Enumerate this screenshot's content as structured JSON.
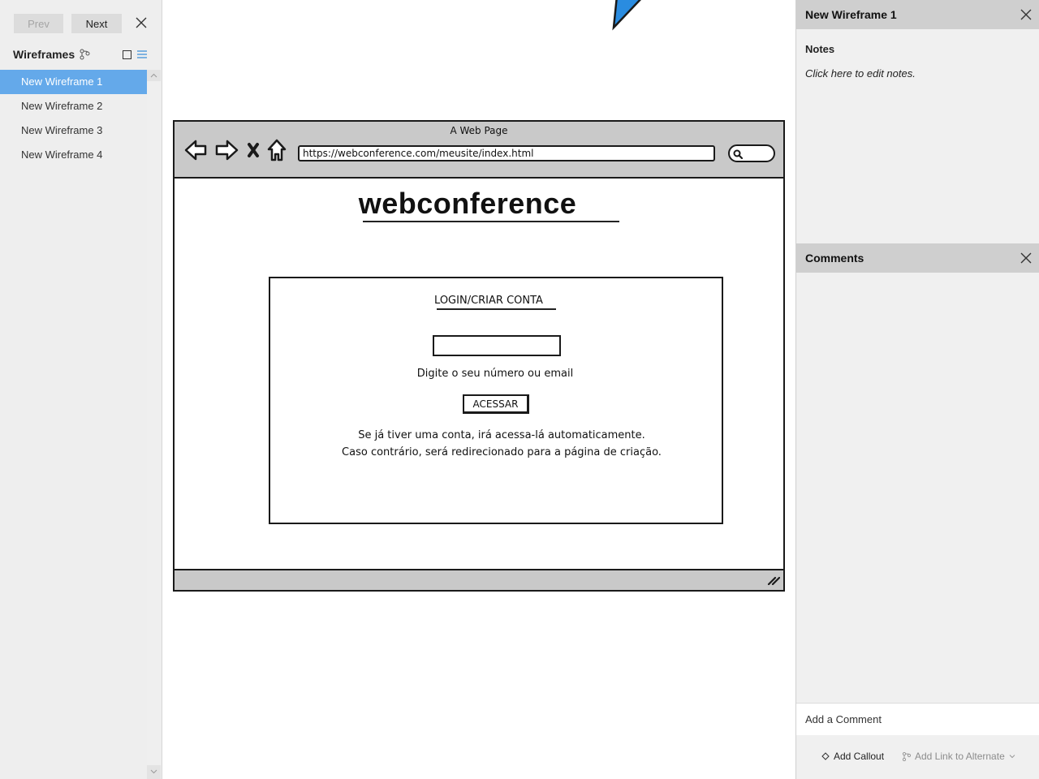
{
  "left_panel": {
    "prev_label": "Prev",
    "next_label": "Next",
    "section_title": "Wireframes",
    "wireframes": [
      {
        "label": "New Wireframe 1",
        "selected": true
      },
      {
        "label": "New Wireframe 2",
        "selected": false
      },
      {
        "label": "New Wireframe 3",
        "selected": false
      },
      {
        "label": "New Wireframe 4",
        "selected": false
      }
    ]
  },
  "canvas": {
    "browser": {
      "title": "A Web Page",
      "url": "https://webconference.com/meusite/index.html"
    },
    "site_title": "webconference",
    "login": {
      "heading": "LOGIN/CRIAR CONTA",
      "input_caption": "Digite o seu número ou email",
      "button_label": "ACESSAR",
      "info_line_1": "Se já tiver uma conta, irá acessa-lá automaticamente.",
      "info_line_2": "Caso contrário, será redirecionado para a página de criação."
    }
  },
  "right_panel": {
    "title": "New Wireframe 1",
    "notes_label": "Notes",
    "notes_placeholder": "Click here to edit notes.",
    "comments_title": "Comments",
    "add_comment_placeholder": "Add a Comment",
    "add_callout_label": "Add Callout",
    "add_link_label": "Add Link to Alternate"
  },
  "colors": {
    "selection": "#64a9ea",
    "arrow_fill": "#2a8ce0",
    "browser_chrome": "#c9c9c9"
  }
}
